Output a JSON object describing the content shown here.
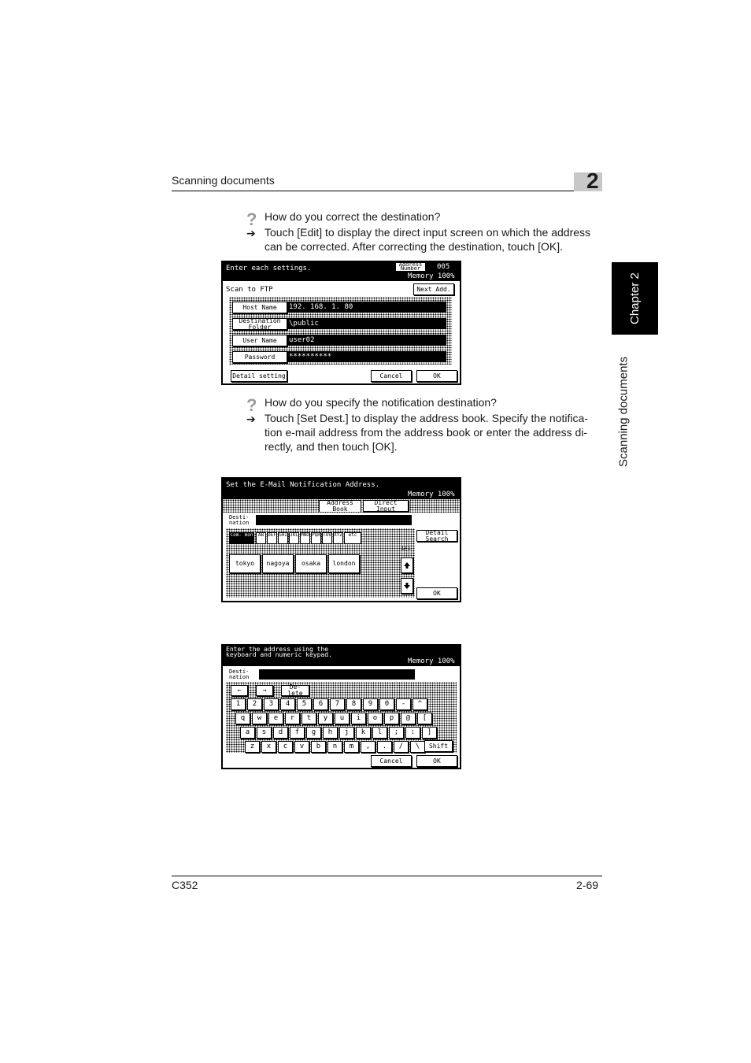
{
  "header": {
    "title": "Scanning documents",
    "chapter_number": "2"
  },
  "side_tab": {
    "chapter": "Chapter 2",
    "section": "Scanning documents"
  },
  "qa": [
    {
      "question": "How do you correct the destination?",
      "answer_line1": "Touch [Edit] to display the direct input screen on which the address",
      "answer_line2": "can be corrected. After correcting the destination, touch [OK]."
    },
    {
      "question": "How do you specify the notification destination?",
      "answer_line1": "Touch [Set Dest.] to display the address book. Specify the notifica-",
      "answer_line2": "tion e-mail address from the address book or enter the address di-",
      "answer_line3": "rectly, and then touch [OK]."
    }
  ],
  "icons": {
    "question": "?",
    "arrow": "➔"
  },
  "screen1": {
    "prompt": "Enter each settings.",
    "address_number_label": "Address Number",
    "address_number_value": "005",
    "memory": "Memory 100%",
    "mode": "Scan to FTP",
    "next_add": "Next Add.",
    "fields": [
      {
        "label": "Host Name",
        "value": "192. 168. 1. 80"
      },
      {
        "label": "Destination Folder",
        "value": "\\public"
      },
      {
        "label": "User Name",
        "value": "user02"
      },
      {
        "label": "Password",
        "value": "**********"
      }
    ],
    "detail_setting": "Detail setting",
    "cancel": "Cancel",
    "ok": "OK"
  },
  "screen2": {
    "prompt": "Set the E-Mail Notification Address.",
    "memory": "Memory 100%",
    "tabs": [
      "Address Book",
      "Direct Input"
    ],
    "destination_label": "Desti- nation",
    "index_keys": [
      "Com- mon",
      "AB",
      "DEF",
      "GHI",
      "JKL",
      "MNO",
      "PQR",
      "TUV",
      "XYZ",
      "etc"
    ],
    "addresses": [
      "tokyo",
      "nagoya",
      "osaka",
      "london"
    ],
    "page_indicator": "1/1",
    "detail_search": "Detail Search",
    "ok": "OK"
  },
  "screen3": {
    "prompt_line1": "Enter the address using the",
    "prompt_line2": "keyboard and numeric keypad.",
    "memory": "Memory 100%",
    "destination_label": "Desti- nation",
    "left_arrow": "←",
    "right_arrow": "→",
    "delete": "De- lete",
    "row1": [
      "1",
      "2",
      "3",
      "4",
      "5",
      "6",
      "7",
      "8",
      "9",
      "0",
      "-",
      "^"
    ],
    "row2": [
      "q",
      "w",
      "e",
      "r",
      "t",
      "y",
      "u",
      "i",
      "o",
      "p",
      "@",
      "["
    ],
    "row3": [
      "a",
      "s",
      "d",
      "f",
      "g",
      "h",
      "j",
      "k",
      "l",
      ";",
      ":",
      "]"
    ],
    "row4": [
      "z",
      "x",
      "c",
      "v",
      "b",
      "n",
      "m",
      ",",
      ".",
      "/",
      "\\"
    ],
    "shift": "Shift",
    "cancel": "Cancel",
    "ok": "OK"
  },
  "footer": {
    "model": "C352",
    "page": "2-69"
  }
}
